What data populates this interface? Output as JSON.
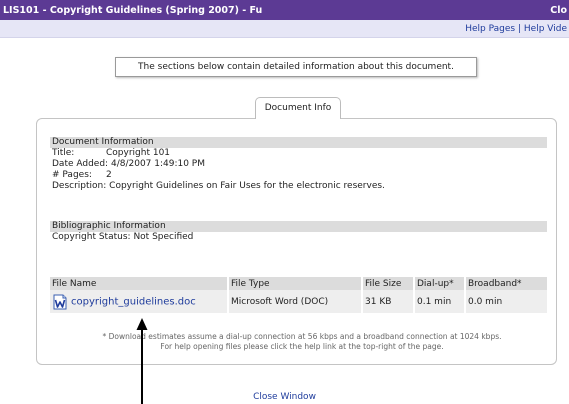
{
  "window": {
    "title": "LIS101 - Copyright Guidelines (Spring 2007) - Fu",
    "title_right": "Clo"
  },
  "help_links": {
    "help_pages": "Help Pages",
    "separator": "|",
    "help_video": "Help Vide"
  },
  "notice": "The sections below contain detailed information about this document.",
  "tab": {
    "label": "Document Info"
  },
  "doc_info": {
    "header": "Document Information",
    "title_label": "Title:",
    "title_value": "Copyright 101",
    "date_label": "Date Added:",
    "date_value": "4/8/2007 1:49:10 PM",
    "pages_label": "# Pages:",
    "pages_value": "2",
    "description_label": "Description:",
    "description_value": "Copyright Guidelines on Fair Uses for the electronic reserves."
  },
  "biblio": {
    "header": "Bibliographic Information",
    "copyright_label": "Copyright Status:",
    "copyright_value": "Not Specified"
  },
  "files": {
    "headers": [
      "File Name",
      "File Type",
      "File Size",
      "Dial-up*",
      "Broadband*"
    ],
    "rows": [
      {
        "icon": "word-doc-icon",
        "name": "copyright_guidelines.doc",
        "type": "Microsoft Word (DOC)",
        "size": "31 KB",
        "dialup": "0.1 min",
        "broadband": "0.0 min"
      }
    ]
  },
  "footnote": {
    "line1": "* Download estimates assume a dial-up connection at 56 kbps and a broadband connection at 1024 kbps.",
    "line2": "For help opening files please click the help link at the top-right of the page."
  },
  "close_window": "Close Window",
  "colors": {
    "titlebar": "#5c3a94",
    "helpbar": "#e6e6f6",
    "link": "#1f3c9c",
    "section_header": "#dcdcdc",
    "row_bg": "#eeeeee"
  }
}
